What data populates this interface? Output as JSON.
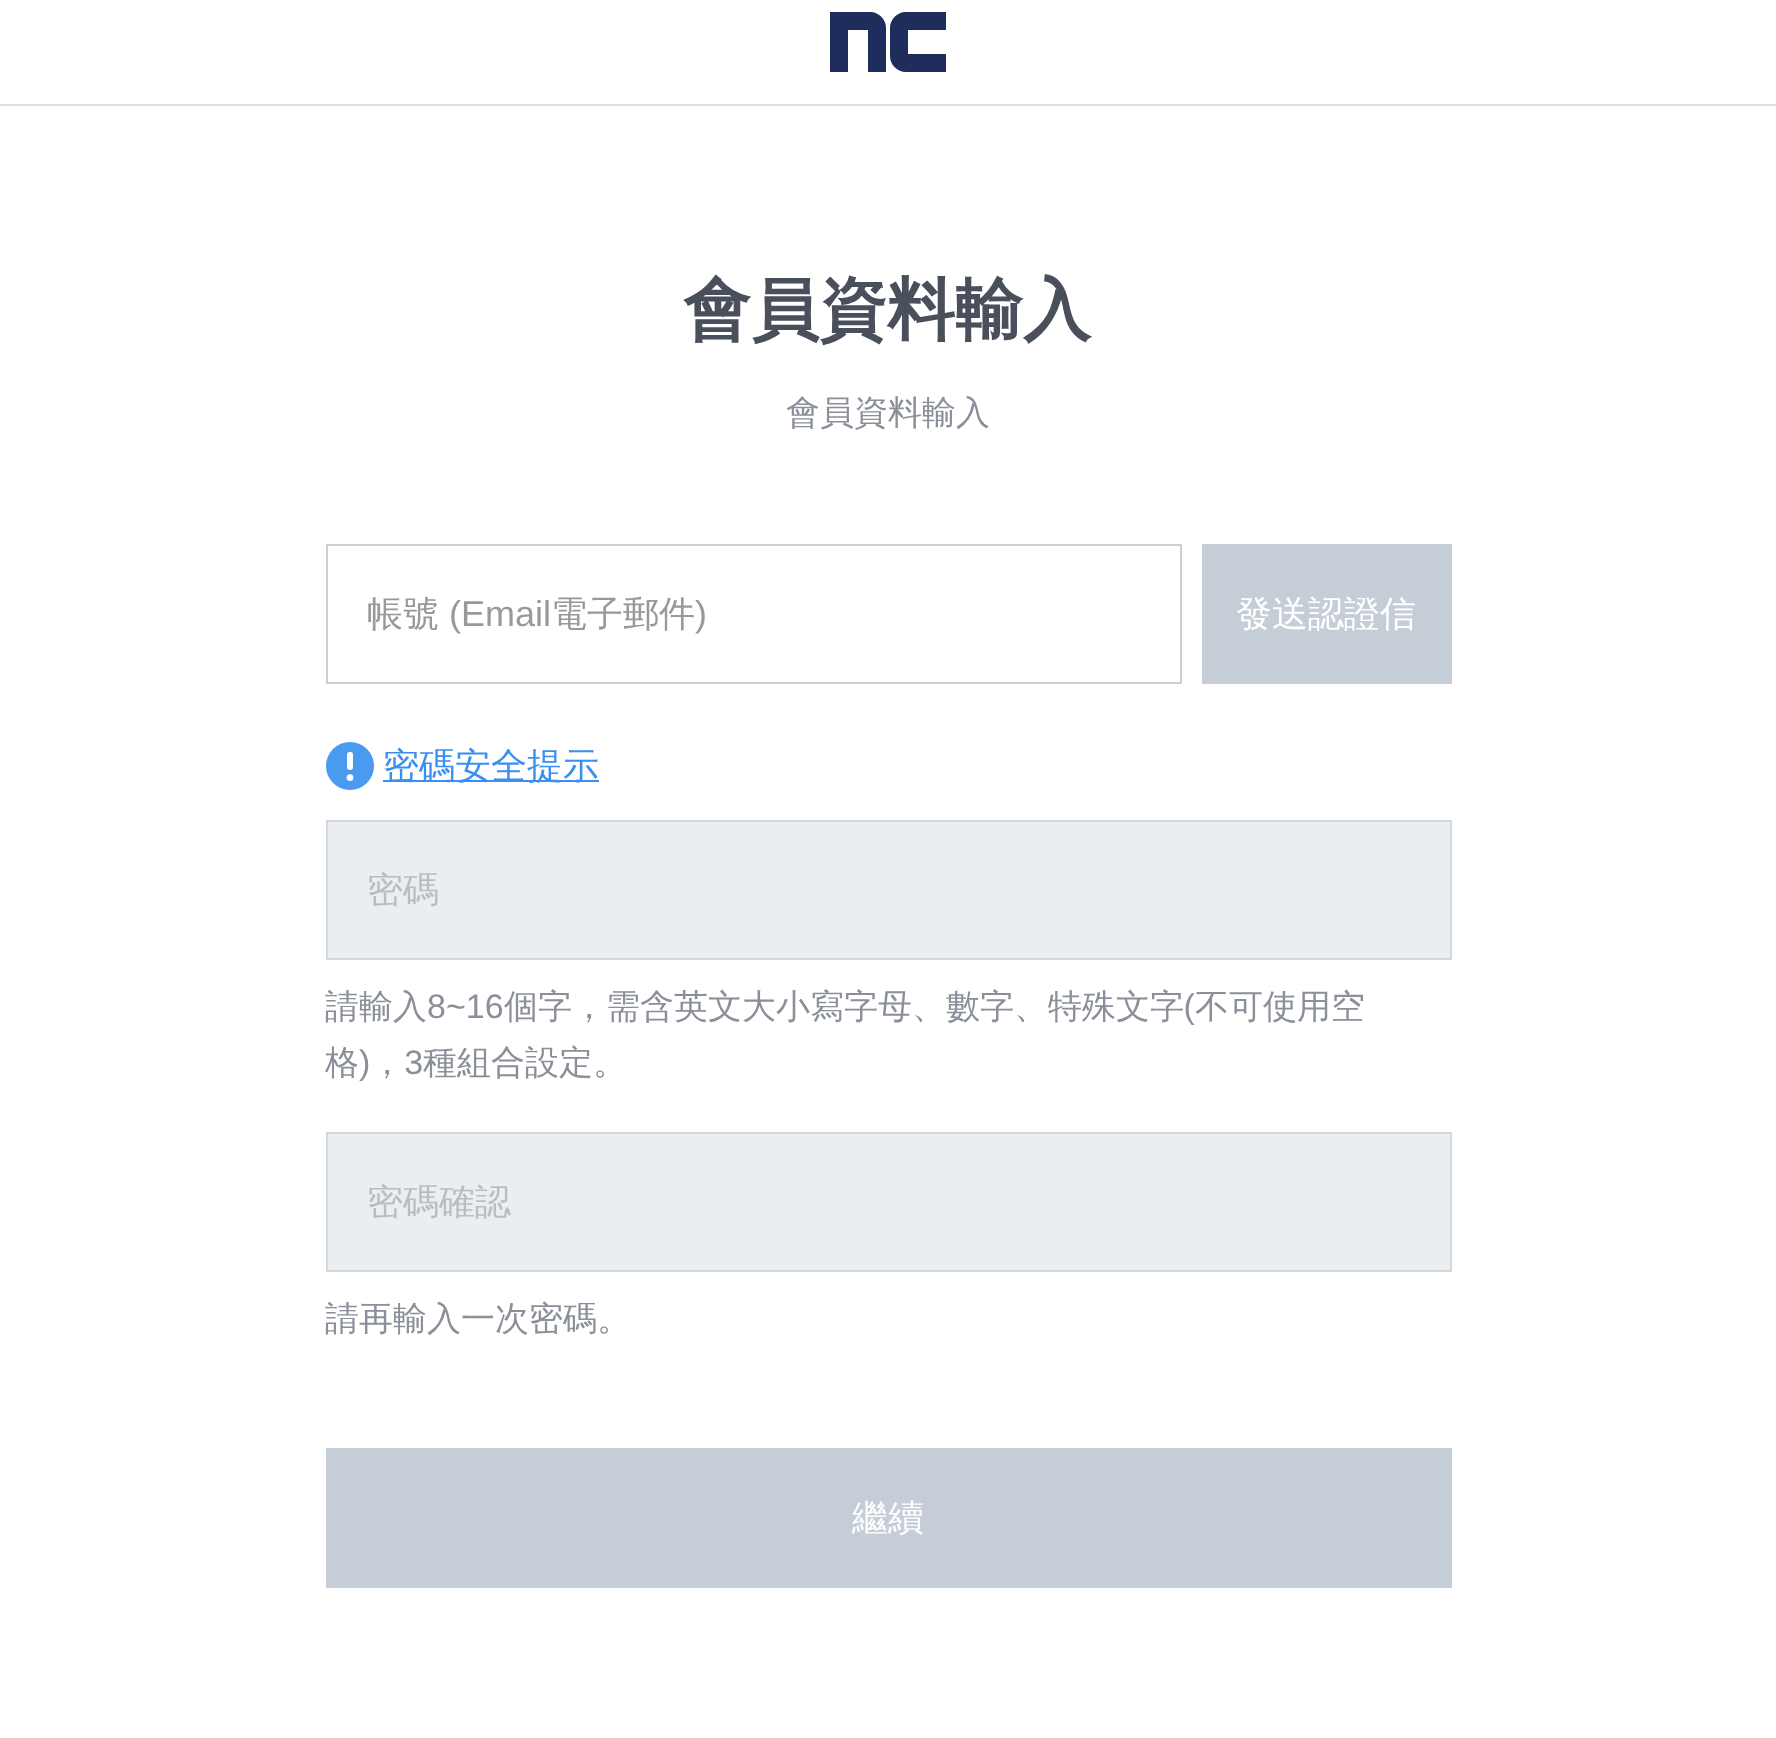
{
  "title": "會員資料輸入",
  "subtitle": "會員資料輸入",
  "email": {
    "placeholder": "帳號 (Email電子郵件)",
    "disabled": false
  },
  "send_button": {
    "label": "發送認證信",
    "disabled": true
  },
  "security_tip": "密碼安全提示",
  "password": {
    "placeholder": "密碼",
    "disabled": true,
    "help": "請輸入8~16個字，需含英文大小寫字母、數字、特殊文字(不可使用空格)，3種組合設定。"
  },
  "password_confirm": {
    "placeholder": "密碼確認",
    "disabled": true,
    "help": "請再輸入一次密碼。"
  },
  "continue_button": {
    "label": "繼續",
    "disabled": true
  }
}
